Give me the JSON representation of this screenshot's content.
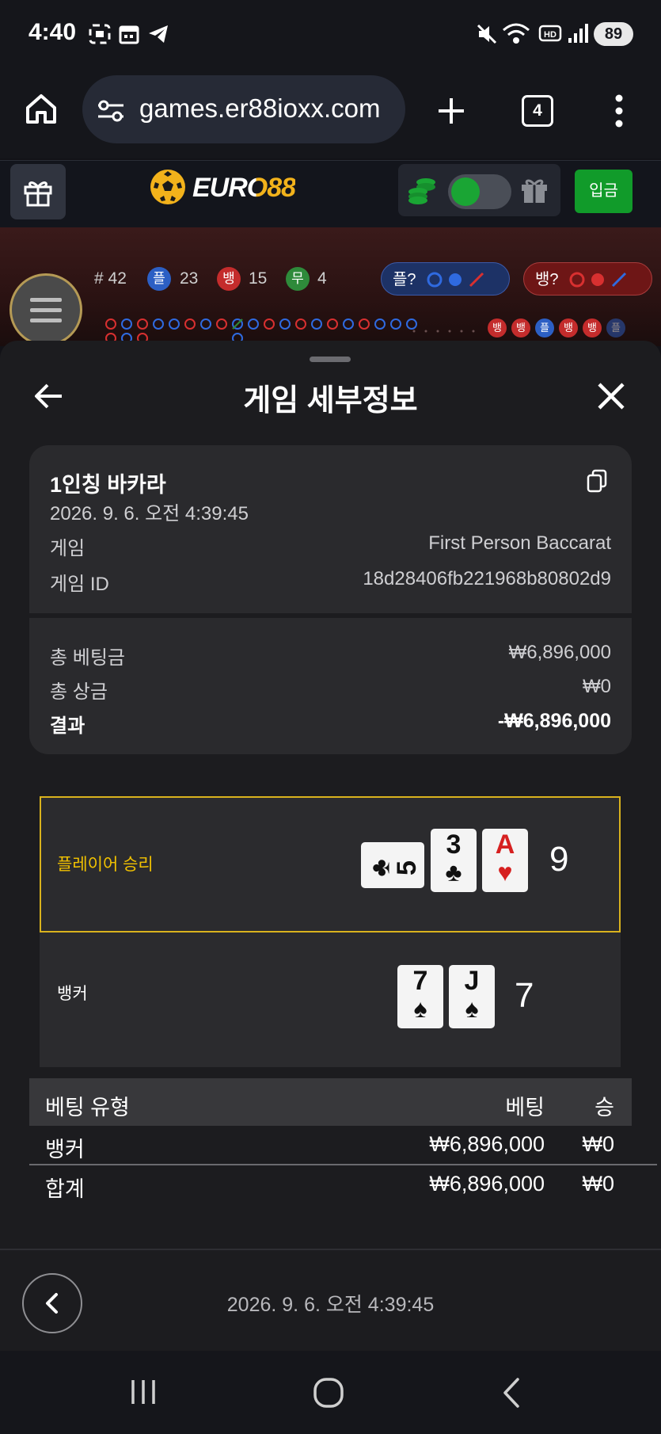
{
  "status_bar": {
    "time": "4:40",
    "battery": "89",
    "left_icons": [
      "screenshot-icon",
      "calendar-icon",
      "telegram-icon"
    ],
    "right_icons": [
      "mute-icon",
      "wifi-icon",
      "hd-icon",
      "signal-icon"
    ]
  },
  "browser": {
    "url": "games.er88ioxx.com",
    "tab_count": "4"
  },
  "site_header": {
    "logo_text": "EURO88",
    "deposit_label": "입금"
  },
  "stats": {
    "round": "# 42",
    "player_badge": "플",
    "player_count": "23",
    "banker_badge": "뱅",
    "banker_count": "15",
    "tie_badge": "무",
    "tie_count": "4",
    "player_predict": "플?",
    "banker_predict": "뱅?",
    "bead_road": [
      "뱅",
      "뱅",
      "플",
      "뱅",
      "뱅",
      "플"
    ],
    "colors": {
      "player": "#2c5fc4",
      "banker": "#c42c2c",
      "tie": "#2e8a3a"
    }
  },
  "modal": {
    "title": "게임 세부정보",
    "game_name": "1인칭 바카라",
    "game_datetime": "2026. 9. 6. 오전 4:39:45",
    "rows": [
      {
        "label": "게임",
        "value": "First Person Baccarat"
      },
      {
        "label": "게임 ID",
        "value": "18d28406fb221968b80802d9"
      }
    ],
    "totals": [
      {
        "label": "총 베팅금",
        "value": "₩6,896,000"
      },
      {
        "label": "총 상금",
        "value": "₩0"
      },
      {
        "label": "결과",
        "value": "-₩6,896,000"
      }
    ],
    "player_hand": {
      "label": "플레이어 승리",
      "score": "9",
      "cards": [
        {
          "rank": "5",
          "suit": "♣",
          "color": "#111111"
        },
        {
          "rank": "3",
          "suit": "♣",
          "color": "#111111"
        },
        {
          "rank": "A",
          "suit": "♥",
          "color": "#d62020"
        }
      ]
    },
    "banker_hand": {
      "label": "뱅커",
      "score": "7",
      "cards": [
        {
          "rank": "7",
          "suit": "♠",
          "color": "#111111"
        },
        {
          "rank": "J",
          "suit": "♠",
          "color": "#111111"
        }
      ]
    },
    "bet_table": {
      "headers": [
        "베팅 유형",
        "베팅",
        "승"
      ],
      "rows": [
        [
          "뱅커",
          "₩6,896,000",
          "₩0"
        ],
        [
          "합계",
          "₩6,896,000",
          "₩0"
        ]
      ]
    },
    "footer_date": "2026. 9. 6. 오전 4:39:45"
  },
  "accent": {
    "win_yellow": "#f2c200",
    "deposit_green": "#119b2a"
  }
}
